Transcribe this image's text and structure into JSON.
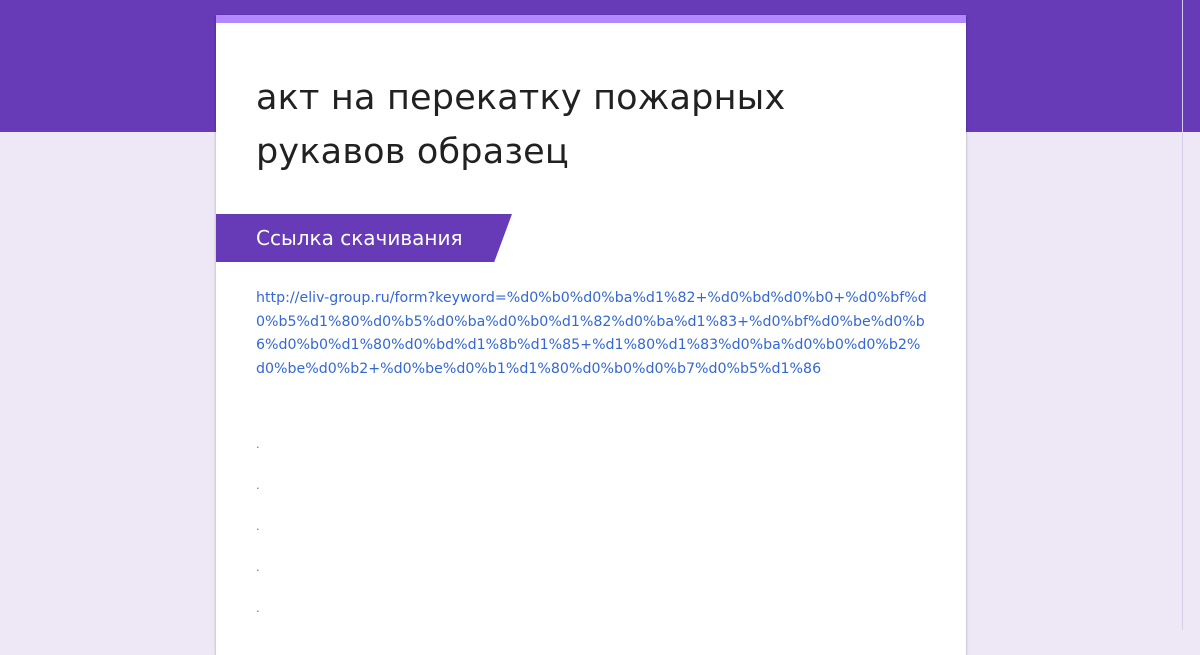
{
  "form": {
    "title": "акт на перекатку пожарных рукавов образец",
    "section_title": "Ссылка скачивания",
    "link_text": "http://eliv-group.ru/form?keyword=%d0%b0%d0%ba%d1%82+%d0%bd%d0%b0+%d0%bf%d0%b5%d1%80%d0%b5%d0%ba%d0%b0%d1%82%d0%ba%d1%83+%d0%bf%d0%be%d0%b6%d0%b0%d1%80%d0%bd%d1%8b%d1%85+%d1%80%d1%83%d0%ba%d0%b0%d0%b2%d0%be%d0%b2+%d0%be%d0%b1%d1%80%d0%b0%d0%b7%d0%b5%d1%86",
    "dots": [
      ".",
      ".",
      ".",
      ".",
      "."
    ]
  },
  "colors": {
    "header": "#673ab7",
    "accent": "#b388ff",
    "background": "#ede7f6",
    "link": "#3367d6"
  }
}
